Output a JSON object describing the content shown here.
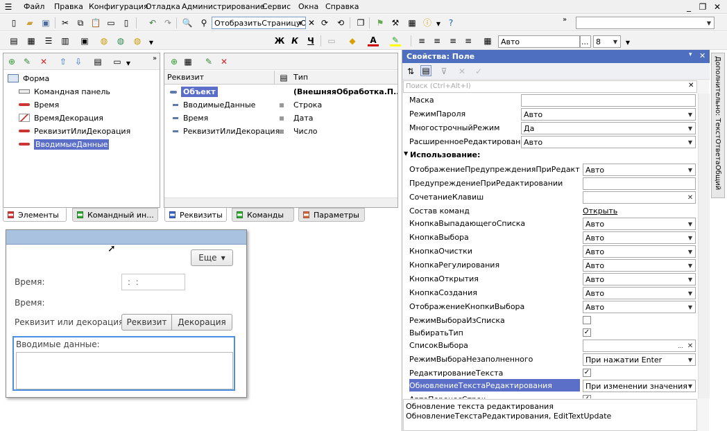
{
  "menu": [
    "Файл",
    "Правка",
    "Конфигурация",
    "Отладка",
    "Администрирование",
    "Сервис",
    "Окна",
    "Справка"
  ],
  "toolbar": {
    "page_combo": "ОтобразитьСтраницуО",
    "font_name": "Авто",
    "font_size": "8",
    "bold": "Ж",
    "italic": "К",
    "underline": "Ч",
    "font_color": "A"
  },
  "elements_tree": {
    "items": [
      "Форма",
      "Командная панель",
      "Время",
      "ВремяДекорация",
      "РеквизитИлиДекорация",
      "ВводимыеДанные"
    ],
    "tabs": [
      "Элементы",
      "Командный ин..."
    ]
  },
  "attributes": {
    "headers": [
      "Реквизит",
      "Тип"
    ],
    "rows": [
      {
        "name": "Объект",
        "type": "(ВнешняяОбработка.П..."
      },
      {
        "name": "ВводимыеДанные",
        "type": "Строка"
      },
      {
        "name": "Время",
        "type": "Дата"
      },
      {
        "name": "РеквизитИлиДекорация",
        "type": "Число"
      }
    ],
    "tabs": [
      "Реквизиты",
      "Команды",
      "Параметры"
    ]
  },
  "preview": {
    "more_button": "Еще",
    "time_label": "Время:",
    "time_value": ":  :",
    "time_label2": "Время:",
    "attr_or_decor_label": "Реквизит или декорация:",
    "btn_attr": "Реквизит",
    "btn_decor": "Декорация",
    "input_label": "Вводимые данные:"
  },
  "properties": {
    "title": "Свойства: Поле",
    "search_placeholder": "Поиск (Ctrl+Alt+I)",
    "section_usage": "Использование:",
    "rows": [
      {
        "label": "Маска",
        "value": "",
        "kind": "text"
      },
      {
        "label": "РежимПароля",
        "value": "Авто",
        "kind": "select"
      },
      {
        "label": "МногострочныйРежим",
        "value": "Да",
        "kind": "select"
      },
      {
        "label": "РасширенноеРедактирование",
        "value": "Авто",
        "kind": "select"
      },
      {
        "label": "ОтображениеПредупрежденияПриРедактирован",
        "value": "Авто",
        "kind": "select"
      },
      {
        "label": "ПредупреждениеПриРедактировании",
        "value": "",
        "kind": "text"
      },
      {
        "label": "СочетаниеКлавиш",
        "value": "",
        "kind": "clear"
      },
      {
        "label": "Состав команд",
        "value": "Открыть",
        "kind": "link"
      },
      {
        "label": "КнопкаВыпадающегоСписка",
        "value": "Авто",
        "kind": "select"
      },
      {
        "label": "КнопкаВыбора",
        "value": "Авто",
        "kind": "select"
      },
      {
        "label": "КнопкаОчистки",
        "value": "Авто",
        "kind": "select"
      },
      {
        "label": "КнопкаРегулирования",
        "value": "Авто",
        "kind": "select"
      },
      {
        "label": "КнопкаОткрытия",
        "value": "Авто",
        "kind": "select"
      },
      {
        "label": "КнопкаСоздания",
        "value": "Авто",
        "kind": "select"
      },
      {
        "label": "ОтображениеКнопкиВыбора",
        "value": "Авто",
        "kind": "select"
      },
      {
        "label": "РежимВыбораИзСписка",
        "value": "",
        "kind": "checkbox"
      },
      {
        "label": "ВыбиратьТип",
        "value": "✓",
        "kind": "checkbox"
      },
      {
        "label": "СписокВыбора",
        "value": "",
        "kind": "list"
      },
      {
        "label": "РежимВыбораНезаполненного",
        "value": "При нажатии Enter",
        "kind": "select"
      },
      {
        "label": "РедактированиеТекста",
        "value": "✓",
        "kind": "checkbox"
      },
      {
        "label": "ОбновлениеТекстаРедактирования",
        "value": "При изменении значения",
        "kind": "select"
      },
      {
        "label": "АвтоПереносСтрок",
        "value": "✓",
        "kind": "checkbox"
      }
    ],
    "description_line1": "Обновление текста редактирования",
    "description_line2": "ОбновлениеТекстаРедактирования, EditTextUpdate",
    "side_tab": "Дополнительно: ТекстОтветаОбщий"
  },
  "colors": {
    "selection": "#5b6fc9",
    "titlebar": "#a9c2df",
    "header_bar": "#dde4ea"
  }
}
